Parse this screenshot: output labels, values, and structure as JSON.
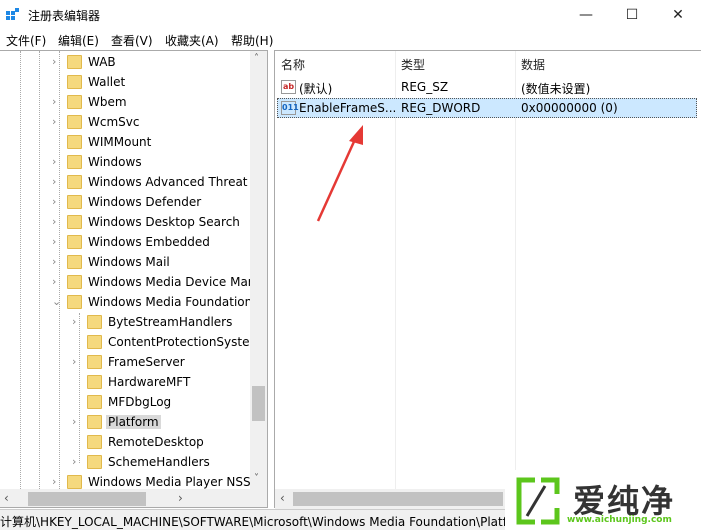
{
  "window": {
    "title": "注册表编辑器",
    "minimize": "—",
    "maximize": "☐",
    "close": "✕"
  },
  "menu": [
    "文件(F)",
    "编辑(E)",
    "查看(V)",
    "收藏夹(A)",
    "帮助(H)"
  ],
  "tree": [
    {
      "label": "WAB",
      "level": 1,
      "expander": "collapsed"
    },
    {
      "label": "Wallet",
      "level": 1,
      "expander": "none"
    },
    {
      "label": "Wbem",
      "level": 1,
      "expander": "collapsed"
    },
    {
      "label": "WcmSvc",
      "level": 1,
      "expander": "collapsed"
    },
    {
      "label": "WIMMount",
      "level": 1,
      "expander": "none"
    },
    {
      "label": "Windows",
      "level": 1,
      "expander": "collapsed"
    },
    {
      "label": "Windows Advanced Threat P",
      "level": 1,
      "expander": "collapsed"
    },
    {
      "label": "Windows Defender",
      "level": 1,
      "expander": "collapsed"
    },
    {
      "label": "Windows Desktop Search",
      "level": 1,
      "expander": "collapsed"
    },
    {
      "label": "Windows Embedded",
      "level": 1,
      "expander": "collapsed"
    },
    {
      "label": "Windows Mail",
      "level": 1,
      "expander": "collapsed"
    },
    {
      "label": "Windows Media Device Mar",
      "level": 1,
      "expander": "collapsed"
    },
    {
      "label": "Windows Media Foundation",
      "level": 1,
      "expander": "expanded"
    },
    {
      "label": "ByteStreamHandlers",
      "level": 2,
      "expander": "collapsed"
    },
    {
      "label": "ContentProtectionSystem",
      "level": 2,
      "expander": "none"
    },
    {
      "label": "FrameServer",
      "level": 2,
      "expander": "collapsed"
    },
    {
      "label": "HardwareMFT",
      "level": 2,
      "expander": "none"
    },
    {
      "label": "MFDbgLog",
      "level": 2,
      "expander": "none"
    },
    {
      "label": "Platform",
      "level": 2,
      "expander": "collapsed",
      "selected": true
    },
    {
      "label": "RemoteDesktop",
      "level": 2,
      "expander": "none"
    },
    {
      "label": "SchemeHandlers",
      "level": 2,
      "expander": "collapsed"
    },
    {
      "label": "Windows Media Player NSS",
      "level": 1,
      "expander": "collapsed"
    }
  ],
  "values": {
    "headers": {
      "name": "名称",
      "type": "类型",
      "data": "数据"
    },
    "rows": [
      {
        "icon": "string-value-icon",
        "icon_text": "ab",
        "name": "(默认)",
        "type": "REG_SZ",
        "data": "(数值未设置)"
      },
      {
        "icon": "binary-value-icon",
        "icon_text": "011",
        "name": "EnableFrameS...",
        "type": "REG_DWORD",
        "data": "0x00000000 (0)",
        "selected": true
      }
    ]
  },
  "status": {
    "path": "计算机\\HKEY_LOCAL_MACHINE\\SOFTWARE\\Microsoft\\Windows Media Foundation\\Platform"
  },
  "watermark": {
    "text": "爱纯净",
    "url": "www.aichunjing.com"
  },
  "colors": {
    "arrow": "#e53935",
    "selection": "#cce8ff",
    "folder": "#f5d97e",
    "watermark_green": "#5cc61c"
  }
}
